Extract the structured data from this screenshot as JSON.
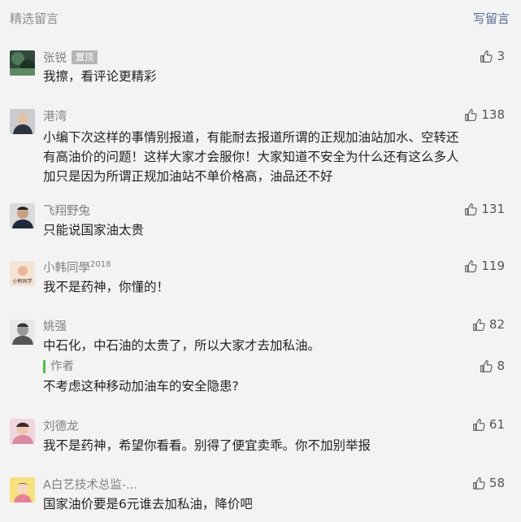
{
  "header": {
    "title": "精选留言",
    "write_label": "写留言"
  },
  "comments": [
    {
      "name": "张锐",
      "badge": "置顶",
      "likes": "3",
      "text": "我擦，看评论更精彩"
    },
    {
      "name": "港湾",
      "likes": "138",
      "text_lines": [
        "小编下次这样的事情别报道，有能耐去报道所谓的正规加油站加水、空转还",
        "有高油价的问题！这样大家才会服你！大家知道不安全为什么还有这么多人",
        "加只是因为所谓正规加油站不单价格高，油品还不好"
      ]
    },
    {
      "name": "飞翔野兔",
      "likes": "131",
      "text": "只能说国家油太贵"
    },
    {
      "name": "小韩同學",
      "name_sup": "2018",
      "likes": "119",
      "text": "我不是药神，你懂的！",
      "avatar_text": "小韩同学"
    },
    {
      "name": "姚强",
      "likes": "82",
      "text": "中石化，中石油的太贵了，所以大家才去加私油。",
      "reply": {
        "label": "作者",
        "likes": "8",
        "text": "不考虑这种移动加油车的安全隐患?"
      }
    },
    {
      "name": "刘德龙",
      "likes": "61",
      "text": "我不是药神，希望你看看。别得了便宜卖乖。你不加别举报"
    },
    {
      "name": "A白艺技术总监-...",
      "likes": "58",
      "text": "国家油价要是6元谁去加私油，降价吧"
    }
  ],
  "colors": {
    "background": "#f3f3f3",
    "link": "#576b95",
    "reply_bar": "#4fbf4f"
  },
  "icons": {
    "like": "thumbs-up-icon"
  }
}
